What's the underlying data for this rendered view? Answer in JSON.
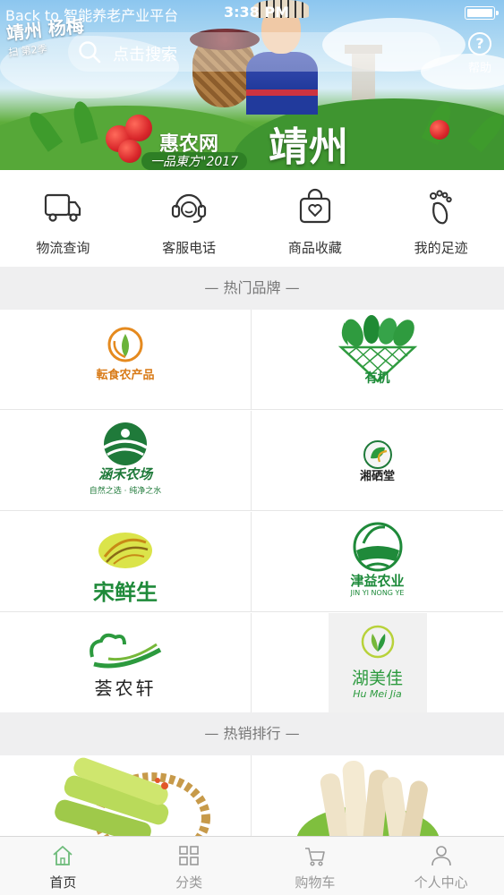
{
  "status_bar": {
    "back_label": "Back to 智能养老产业平台",
    "time": "3:38 PM"
  },
  "banner": {
    "brand_line": "惠农网",
    "slogan": "一品東方\"2017",
    "city": "靖州",
    "corner_logo": "靖州 杨梅",
    "corner_small": "扫 第2季"
  },
  "search": {
    "placeholder": "点击搜索",
    "icon": "search-icon"
  },
  "help": {
    "label": "帮助",
    "icon_glyph": "?"
  },
  "quick_actions": [
    {
      "label": "物流查询",
      "icon": "truck-icon"
    },
    {
      "label": "客服电话",
      "icon": "headset-icon"
    },
    {
      "label": "商品收藏",
      "icon": "favorite-bag-icon"
    },
    {
      "label": "我的足迹",
      "icon": "footprint-icon"
    }
  ],
  "hot_brands": {
    "title": "— 热门品牌 —",
    "items": [
      {
        "name": "転食农产品"
      },
      {
        "name": "有机"
      },
      {
        "name": "涵禾农场",
        "sub": "自然之选 · 纯净之水"
      },
      {
        "name": "湘硒堂"
      },
      {
        "name": "宋鲜生"
      },
      {
        "name": "津益农业",
        "sub": "JIN YI NONG YE"
      },
      {
        "name": "荟农轩"
      },
      {
        "name": "湖美佳",
        "sub": "Hu Mei Jia"
      }
    ]
  },
  "hot_sales": {
    "title": "— 热销排行 —"
  },
  "tab_bar": {
    "tabs": [
      {
        "label": "首页",
        "icon": "home-icon",
        "active": true
      },
      {
        "label": "分类",
        "icon": "category-grid-icon",
        "active": false
      },
      {
        "label": "购物车",
        "icon": "cart-icon",
        "active": false
      },
      {
        "label": "个人中心",
        "icon": "person-icon",
        "active": false
      }
    ]
  },
  "colors": {
    "brand_green": "#1d8a3a",
    "tab_active": "#333333",
    "tab_inactive": "#999999",
    "section_bg": "#efeff0"
  }
}
